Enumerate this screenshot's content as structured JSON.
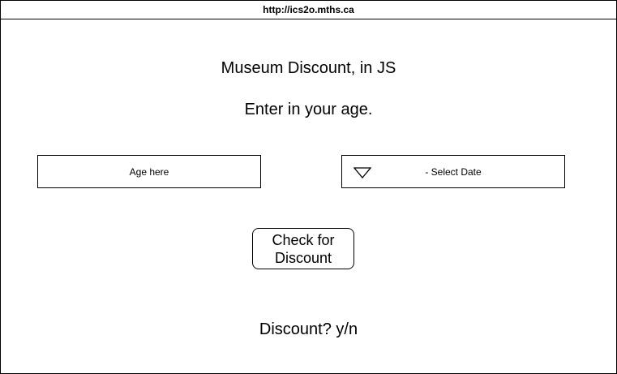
{
  "browser": {
    "url": "http://ics2o.mths.ca"
  },
  "page": {
    "title": "Museum Discount, in JS",
    "prompt": "Enter in your age."
  },
  "form": {
    "age_placeholder": "Age here",
    "date_select_label": "- Select Date",
    "check_button_label": "Check for Discount"
  },
  "result": {
    "text": "Discount? y/n"
  },
  "icons": {
    "dropdown": "triangle-down-icon"
  }
}
